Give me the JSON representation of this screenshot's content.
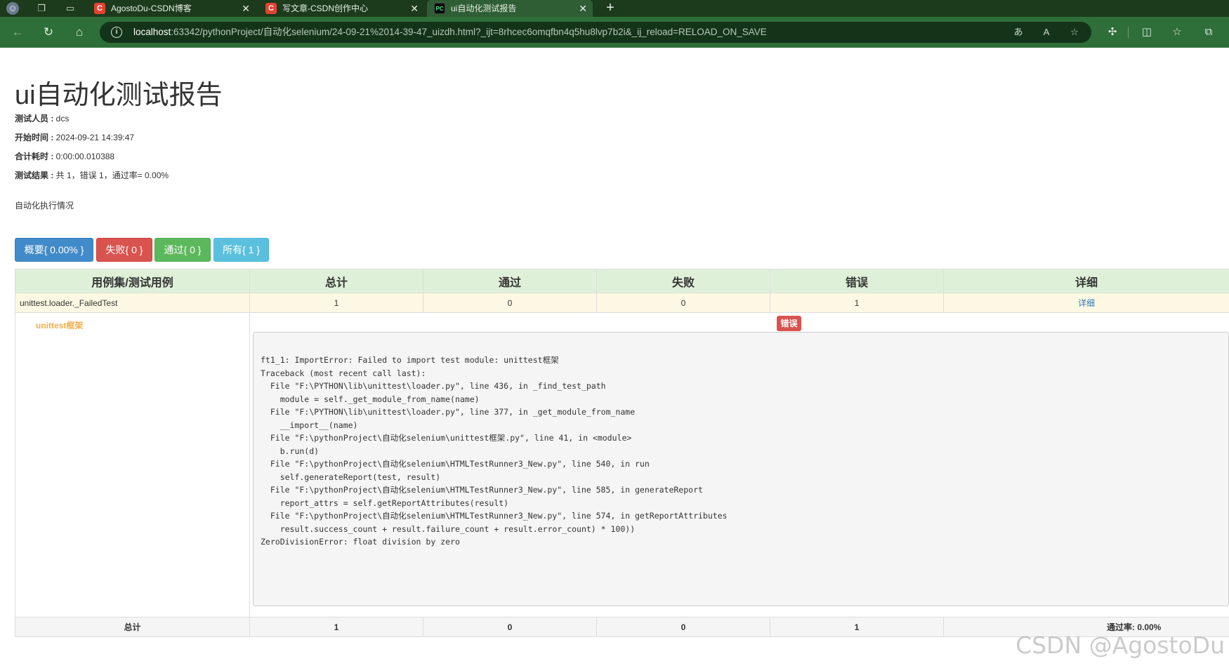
{
  "browser": {
    "tabs": [
      {
        "title": "AgostoDu-CSDN博客",
        "favicon": "C",
        "active": false
      },
      {
        "title": "写文章-CSDN创作中心",
        "favicon": "C",
        "active": false
      },
      {
        "title": "ui自动化测试报告",
        "favicon": "PC",
        "active": true
      }
    ],
    "url_host": "localhost",
    "url_rest": ":63342/pythonProject/自动化selenium/24-09-21%2014-39-47_uizdh.html?_ijt=8rhcec6omqfbn4q5hu8lvp7b2i&_ij_reload=RELOAD_ON_SAVE",
    "colors": {
      "tabbar": "#1c3a1c",
      "toolbar": "#2e6e38",
      "urlbox": "#14341a"
    }
  },
  "report": {
    "title": "ui自动化测试报告",
    "meta": [
      {
        "label": "测试人员 :",
        "value": " dcs"
      },
      {
        "label": "开始时间 :",
        "value": " 2024-09-21 14:39:47"
      },
      {
        "label": "合计耗时 :",
        "value": " 0:00:00.010388"
      },
      {
        "label": "测试结果 :",
        "value": " 共 1，错误 1，通过率= 0.00%"
      }
    ],
    "description": "自动化执行情况",
    "filters": [
      {
        "label": "概要{ 0.00% }",
        "color": "#428bca"
      },
      {
        "label": "失败{ 0 }",
        "color": "#d9534f"
      },
      {
        "label": "通过{ 0 }",
        "color": "#5cb85c"
      },
      {
        "label": "所有{ 1 }",
        "color": "#5bc0de"
      }
    ],
    "table": {
      "headers": [
        "用例集/测试用例",
        "总计",
        "通过",
        "失败",
        "错误",
        "详细"
      ],
      "class_row": {
        "name": "unittest.loader._FailedTest",
        "total": "1",
        "pass": "0",
        "fail": "0",
        "error": "1",
        "detail": "详细"
      },
      "case": {
        "name": "unittest框架",
        "status": "错误",
        "traceback": "ft1_1: ImportError: Failed to import test module: unittest框架\nTraceback (most recent call last):\n  File \"F:\\PYTHON\\lib\\unittest\\loader.py\", line 436, in _find_test_path\n    module = self._get_module_from_name(name)\n  File \"F:\\PYTHON\\lib\\unittest\\loader.py\", line 377, in _get_module_from_name\n    __import__(name)\n  File \"F:\\pythonProject\\自动化selenium\\unittest框架.py\", line 41, in <module>\n    b.run(d)\n  File \"F:\\pythonProject\\自动化selenium\\HTMLTestRunner3_New.py\", line 540, in run\n    self.generateReport(test, result)\n  File \"F:\\pythonProject\\自动化selenium\\HTMLTestRunner3_New.py\", line 585, in generateReport\n    report_attrs = self.getReportAttributes(result)\n  File \"F:\\pythonProject\\自动化selenium\\HTMLTestRunner3_New.py\", line 574, in getReportAttributes\n    result.success_count + result.failure_count + result.error_count) * 100))\nZeroDivisionError: float division by zero"
      },
      "total_row": {
        "label": "总计",
        "total": "1",
        "pass": "0",
        "fail": "0",
        "error": "1",
        "rate": "通过率: 0.00%"
      }
    }
  },
  "watermark": "CSDN @AgostoDu"
}
